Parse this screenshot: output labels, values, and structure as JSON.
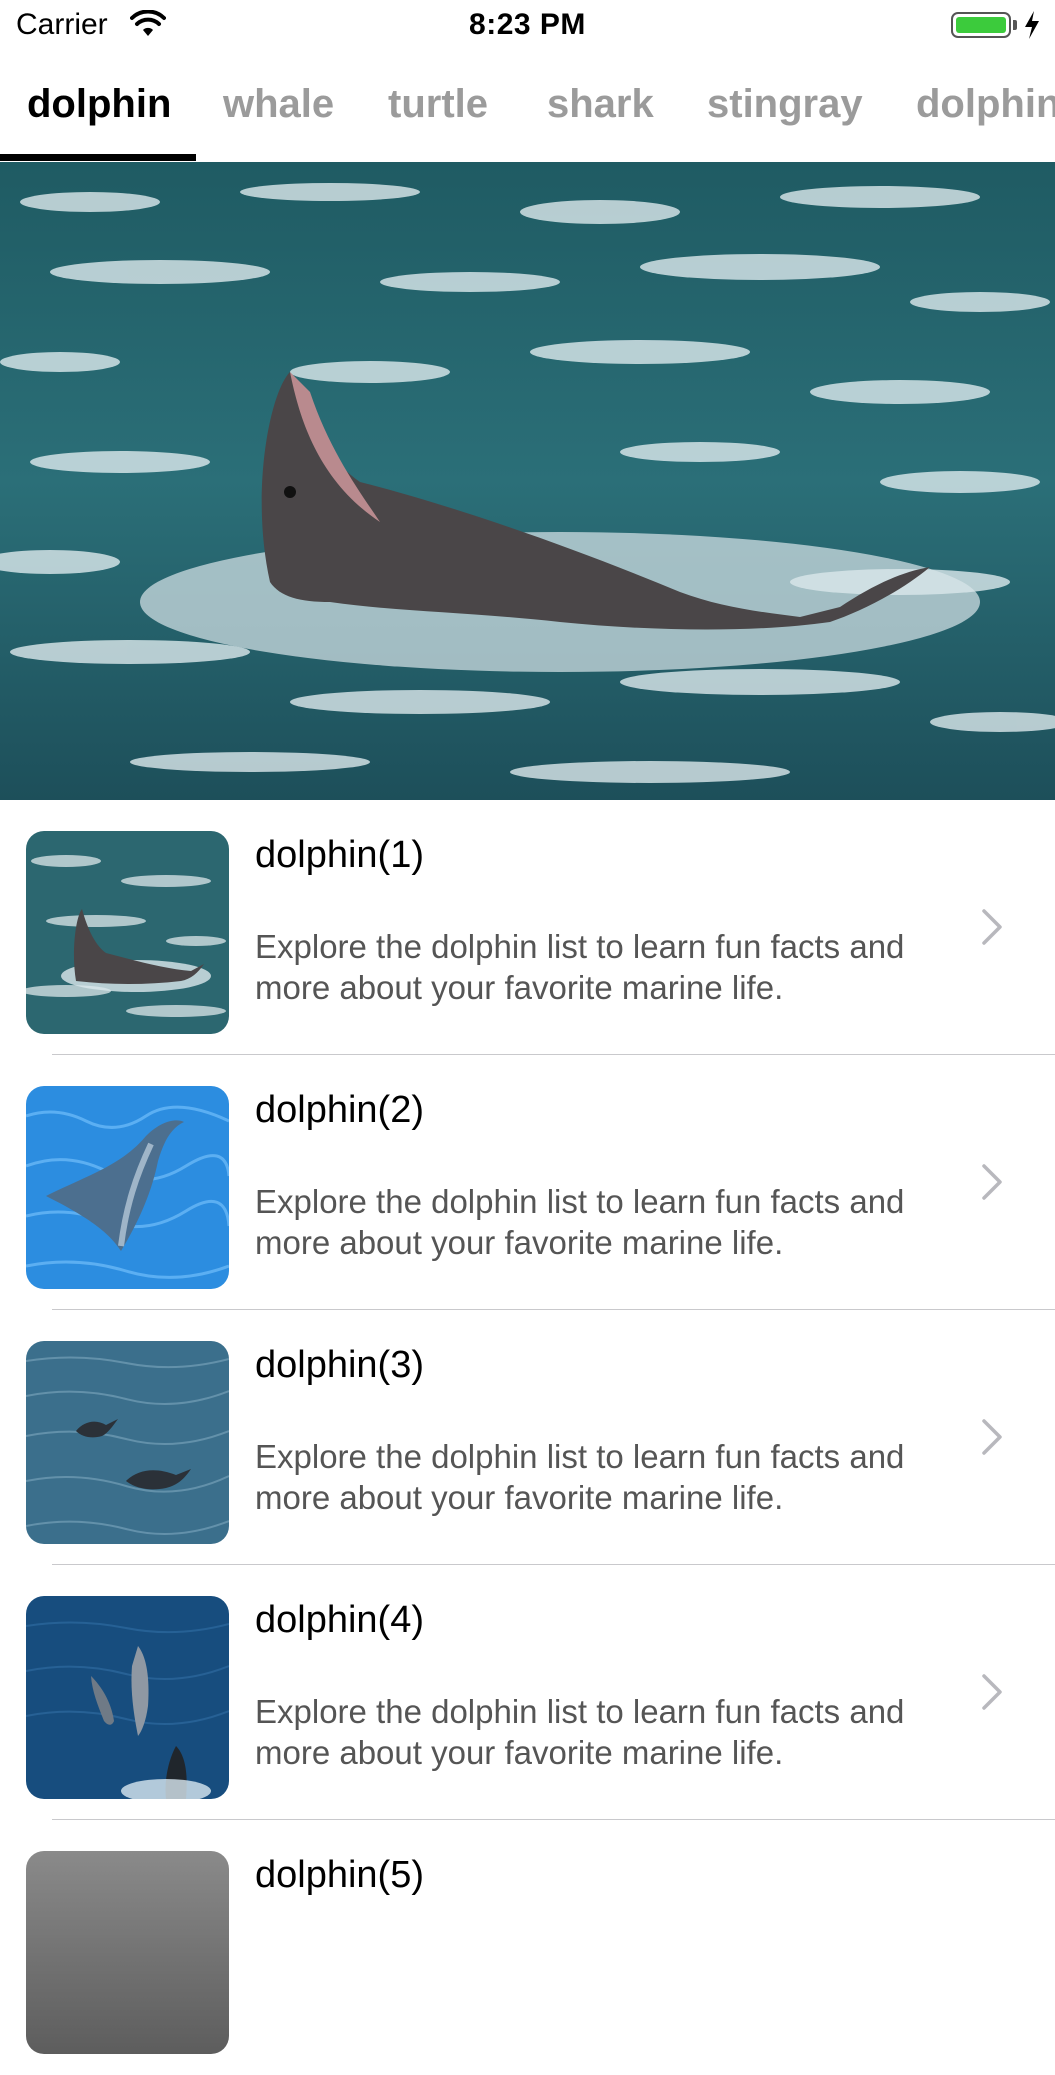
{
  "status_bar": {
    "carrier": "Carrier",
    "time": "8:23 PM"
  },
  "tabs": [
    {
      "label": "dolphin",
      "active": true
    },
    {
      "label": "whale",
      "active": false
    },
    {
      "label": "turtle",
      "active": false
    },
    {
      "label": "shark",
      "active": false
    },
    {
      "label": "stingray",
      "active": false
    },
    {
      "label": "dolphin",
      "active": false
    }
  ],
  "list": [
    {
      "title": "dolphin(1)",
      "description": "Explore the dolphin list to learn fun facts and more about your favorite marine life."
    },
    {
      "title": "dolphin(2)",
      "description": "Explore the dolphin list to learn fun facts and more about your favorite marine life."
    },
    {
      "title": "dolphin(3)",
      "description": "Explore the dolphin list to learn fun facts and more about your favorite marine life."
    },
    {
      "title": "dolphin(4)",
      "description": "Explore the dolphin list to learn fun facts and more about your favorite marine life."
    },
    {
      "title": "dolphin(5)",
      "description": ""
    }
  ],
  "colors": {
    "accent": "#000000",
    "inactive_tab": "#9b9b9b",
    "battery": "#3ccb3c"
  },
  "icons": [
    "wifi-icon",
    "battery-icon",
    "charging-bolt-icon",
    "chevron-right-icon"
  ]
}
